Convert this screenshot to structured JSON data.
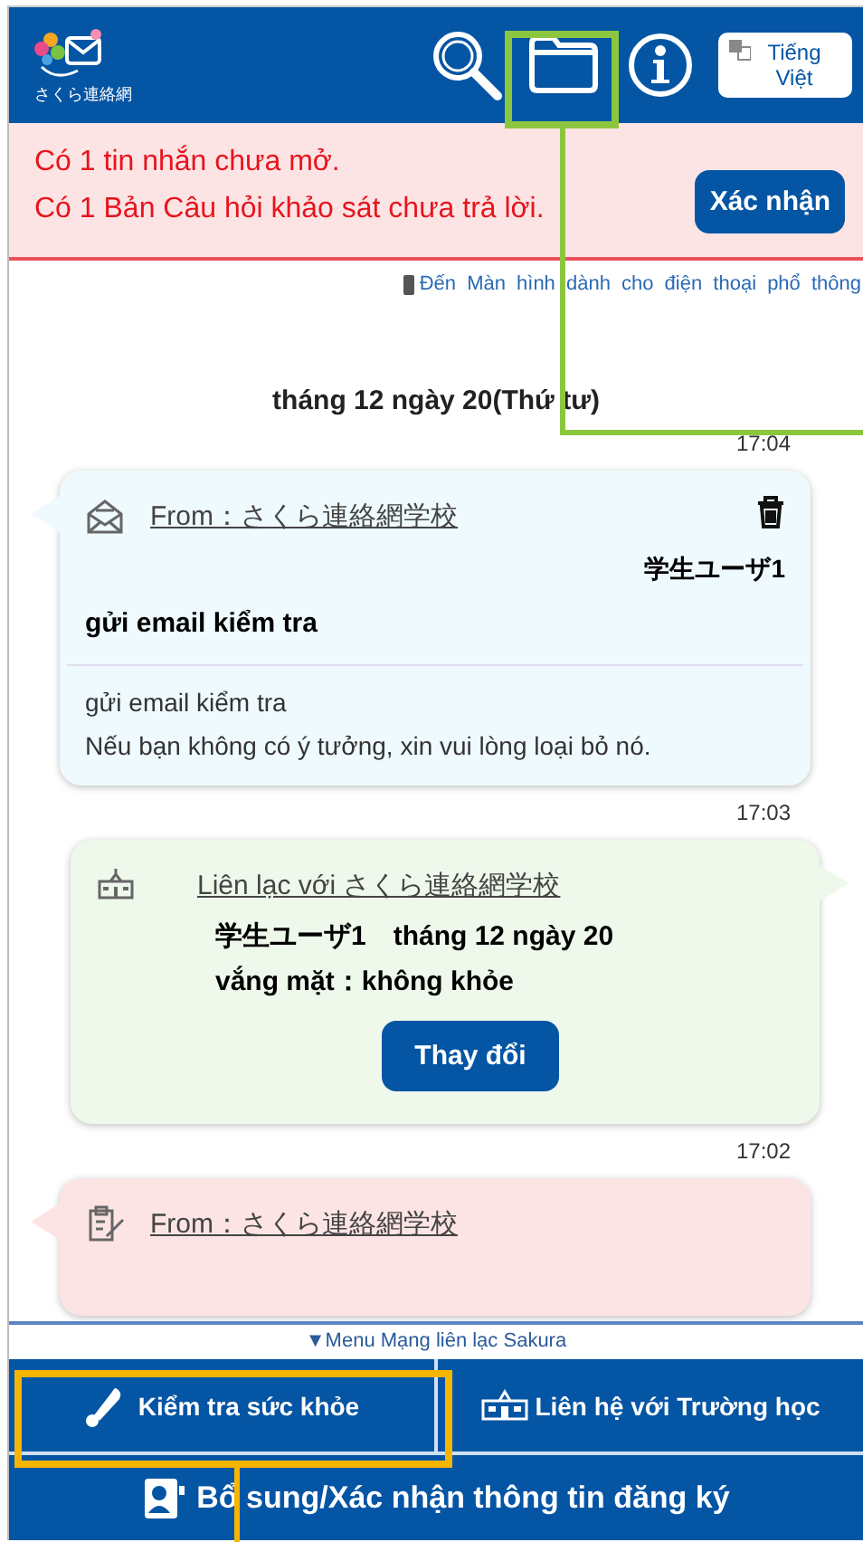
{
  "header": {
    "logo_text": "さくら連絡網",
    "language_button": [
      "Tiếng",
      "Việt"
    ]
  },
  "alert": {
    "lines": [
      "Có 1 tin nhắn chưa mở.",
      "Có 1 Bản Câu hỏi khảo sát chưa trả lời."
    ],
    "button": "Xác nhận"
  },
  "feature_phone_link": "Đến Màn hình dành cho điện thoại phổ thông",
  "date": "tháng 12 ngày 20(Thứ tư)",
  "messages": [
    {
      "kind": "mail",
      "time": "17:04",
      "from": "From：さくら連絡網学校",
      "recipient": "学生ユーザ1",
      "subject": "gửi email kiểm tra",
      "body": [
        "gửi email kiểm tra",
        "Nếu bạn không có ý tưởng, xin vui lòng loại bỏ nó."
      ]
    },
    {
      "kind": "contact",
      "time": "17:03",
      "title": "Liên lạc với さくら連絡網学校",
      "lines": [
        "学生ユーザ1　tháng 12 ngày 20",
        "vắng mặt：không khỏe"
      ],
      "button": "Thay đổi"
    },
    {
      "kind": "survey",
      "time": "17:02",
      "from": "From：さくら連絡網学校"
    }
  ],
  "menu": {
    "toggle": "▼Menu Mạng liên lạc Sakura",
    "buttons": [
      {
        "kind": "thermometer",
        "label": "Kiểm tra sức khỏe"
      },
      {
        "kind": "school",
        "label": "Liên hệ với Trường học"
      },
      {
        "kind": "profile",
        "label": "Bổ sung/Xác nhận thông tin đăng ký"
      }
    ]
  },
  "annotations": [
    {
      "kind": "folder",
      "color": "#8cc63f"
    },
    {
      "kind": "health",
      "color": "#f7b500"
    }
  ]
}
